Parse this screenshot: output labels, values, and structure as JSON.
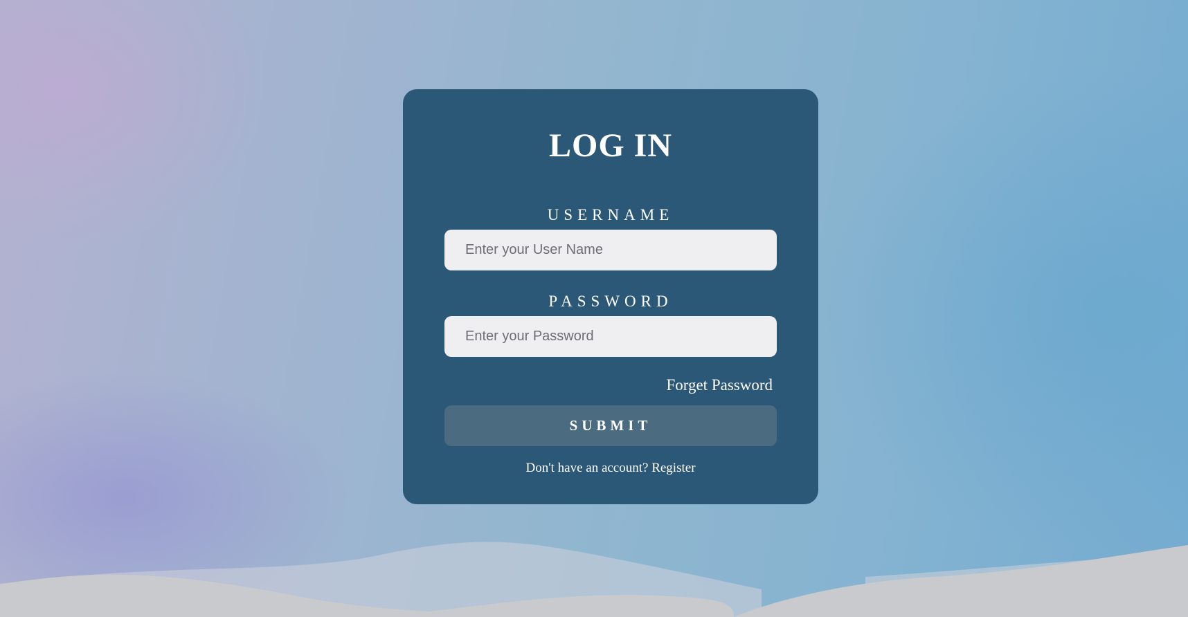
{
  "login": {
    "title": "LOG IN",
    "username_label": "USERNAME",
    "username_placeholder": "Enter your User Name",
    "password_label": "PASSWORD",
    "password_placeholder": "Enter your Password",
    "forget_password": "Forget Password",
    "submit_label": "SUBMIT",
    "register_prompt": "Don't have an account?",
    "register_link": "Register"
  },
  "colors": {
    "card_background": "#2c5878",
    "input_background": "#efeff2",
    "submit_background": "#4b6c80",
    "text": "#ffffff"
  }
}
